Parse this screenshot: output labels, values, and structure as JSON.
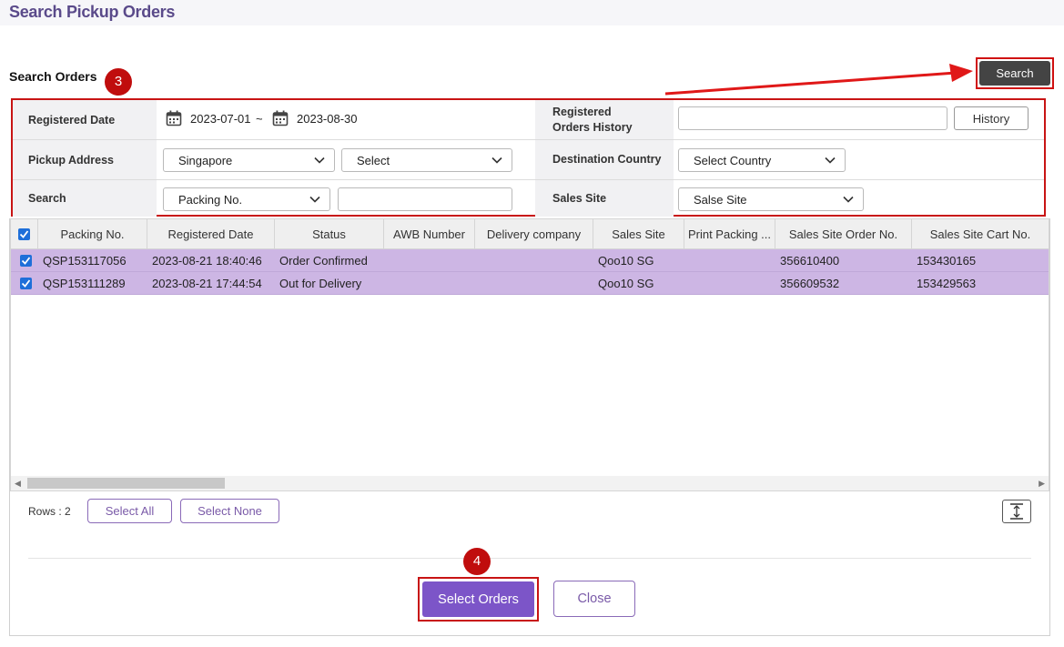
{
  "page": {
    "title": "Search Pickup Orders"
  },
  "section": {
    "title": "Search Orders"
  },
  "annotations": {
    "step3": "3",
    "step4": "4",
    "accent": "#c81414"
  },
  "toolbar": {
    "search_label": "Search"
  },
  "form": {
    "registered_date": {
      "label": "Registered Date",
      "from": "2023-07-01",
      "separator": "~",
      "to": "2023-08-30"
    },
    "orders_history": {
      "label_line1": "Registered",
      "label_line2": "Orders History",
      "value": "",
      "button": "History"
    },
    "pickup_address": {
      "label": "Pickup Address",
      "country": "Singapore",
      "address": "Select"
    },
    "destination_country": {
      "label": "Destination Country",
      "value": "Select Country"
    },
    "search": {
      "label": "Search",
      "field": "Packing No.",
      "value": ""
    },
    "sales_site": {
      "label": "Sales Site",
      "value": "Salse Site"
    }
  },
  "grid": {
    "columns": [
      "Packing No.",
      "Registered Date",
      "Status",
      "AWB Number",
      "Delivery company",
      "Sales Site",
      "Print Packing ...",
      "Sales Site Order No.",
      "Sales Site Cart No."
    ],
    "rows": [
      {
        "selected": true,
        "packing_no": "QSP153117056",
        "registered_date": "2023-08-21 18:40:46",
        "status": "Order Confirmed",
        "awb": "",
        "delivery": "",
        "sales_site": "Qoo10 SG",
        "print": "",
        "order_no": "356610400",
        "cart_no": "153430165"
      },
      {
        "selected": true,
        "packing_no": "QSP153111289",
        "registered_date": "2023-08-21 17:44:54",
        "status": "Out for Delivery",
        "awb": "",
        "delivery": "",
        "sales_site": "Qoo10 SG",
        "print": "",
        "order_no": "356609532",
        "cart_no": "153429563"
      }
    ],
    "row_highlight": "#cdb6e4"
  },
  "footer": {
    "rows_count": "Rows : 2",
    "select_all": "Select All",
    "select_none": "Select None",
    "select_orders": "Select Orders",
    "close": "Close"
  },
  "colors": {
    "primary": "#7c55c8",
    "title": "#5a4a8a",
    "checkbox": "#1e6fd9"
  }
}
